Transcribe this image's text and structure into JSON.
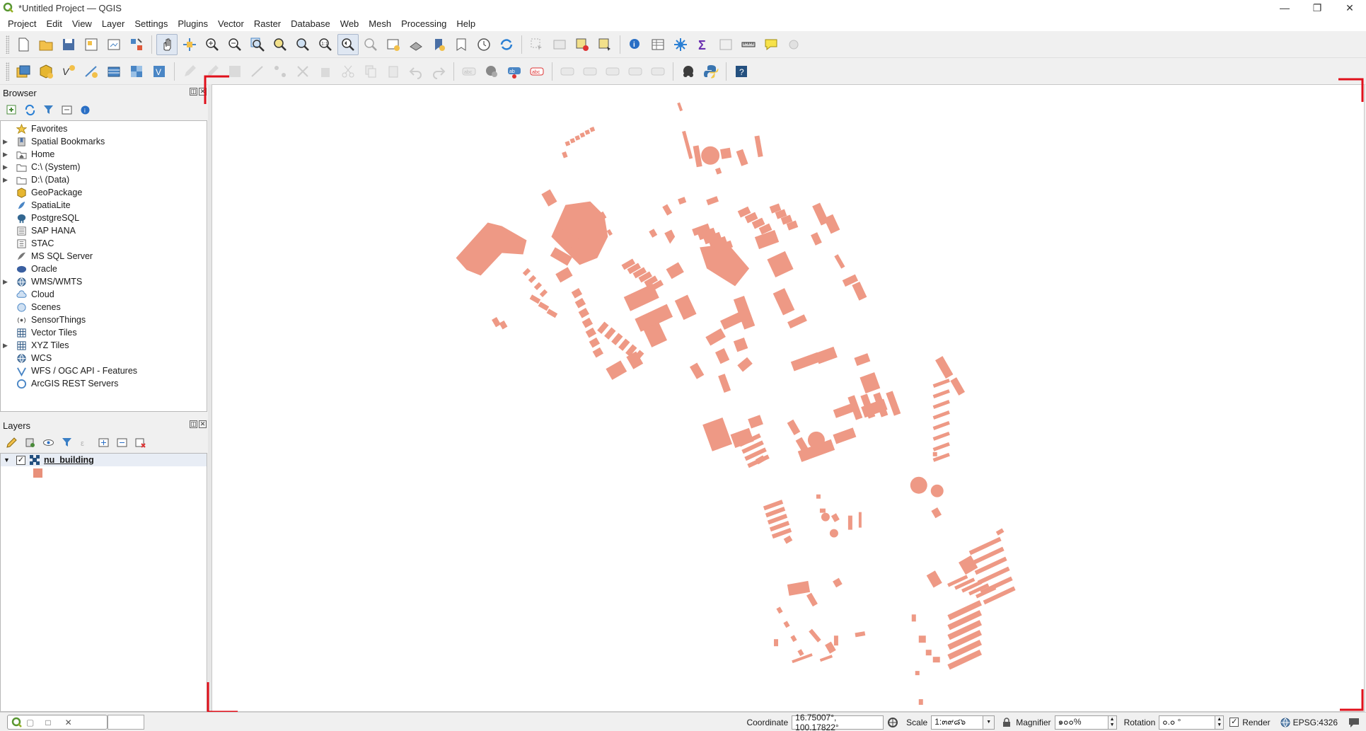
{
  "window": {
    "title": "*Untitled Project — QGIS",
    "minimize": "—",
    "restore": "❐",
    "close": "✕"
  },
  "menu": [
    "Project",
    "Edit",
    "View",
    "Layer",
    "Settings",
    "Plugins",
    "Vector",
    "Raster",
    "Database",
    "Web",
    "Mesh",
    "Processing",
    "Help"
  ],
  "browser": {
    "title": "Browser",
    "items": [
      {
        "label": "Favorites",
        "icon": "star-icon",
        "expand": false
      },
      {
        "label": "Spatial Bookmarks",
        "icon": "bookmark-icon",
        "expand": true
      },
      {
        "label": "Home",
        "icon": "home-folder-icon",
        "expand": true
      },
      {
        "label": "C:\\ (System)",
        "icon": "folder-icon",
        "expand": true
      },
      {
        "label": "D:\\ (Data)",
        "icon": "folder-icon",
        "expand": true
      },
      {
        "label": "GeoPackage",
        "icon": "geopackage-icon",
        "expand": false
      },
      {
        "label": "SpatiaLite",
        "icon": "spatialite-icon",
        "expand": false
      },
      {
        "label": "PostgreSQL",
        "icon": "postgresql-icon",
        "expand": false
      },
      {
        "label": "SAP HANA",
        "icon": "sap-hana-icon",
        "expand": false
      },
      {
        "label": "STAC",
        "icon": "stac-icon",
        "expand": false
      },
      {
        "label": "MS SQL Server",
        "icon": "mssql-icon",
        "expand": false
      },
      {
        "label": "Oracle",
        "icon": "oracle-icon",
        "expand": false
      },
      {
        "label": "WMS/WMTS",
        "icon": "globe-icon",
        "expand": true
      },
      {
        "label": "Cloud",
        "icon": "cloud-icon",
        "expand": false
      },
      {
        "label": "Scenes",
        "icon": "scenes-icon",
        "expand": false
      },
      {
        "label": "SensorThings",
        "icon": "sensor-icon",
        "expand": false
      },
      {
        "label": "Vector Tiles",
        "icon": "grid-icon",
        "expand": false
      },
      {
        "label": "XYZ Tiles",
        "icon": "grid-icon",
        "expand": true
      },
      {
        "label": "WCS",
        "icon": "globe-icon",
        "expand": false
      },
      {
        "label": "WFS / OGC API - Features",
        "icon": "wfs-icon",
        "expand": false
      },
      {
        "label": "ArcGIS REST Servers",
        "icon": "arcgis-icon",
        "expand": false
      }
    ]
  },
  "layers": {
    "title": "Layers",
    "items": [
      {
        "name": "nu_building",
        "checked": true,
        "fill": "#e8907a"
      }
    ]
  },
  "map": {
    "building_fill": "#ee9985"
  },
  "status": {
    "coordinate_label": "Coordinate",
    "coordinate_value": "16.75007°, 100.17822°",
    "scale_label": "Scale",
    "scale_value": "1:๓๙๘๖",
    "magnifier_label": "Magnifier",
    "magnifier_value": "๑๐๐%",
    "rotation_label": "Rotation",
    "rotation_value": "๐.๐ °",
    "render_label": "Render",
    "render_checked": true,
    "crs_value": "EPSG:4326"
  }
}
